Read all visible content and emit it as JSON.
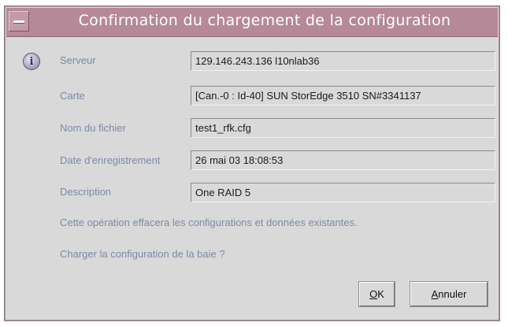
{
  "dialog": {
    "title": "Confirmation du chargement de la configuration"
  },
  "fields": [
    {
      "label": "Serveur",
      "value": "129.146.243.136 l10nlab36"
    },
    {
      "label": "Carte",
      "value": "[Can.-0 : Id-40] SUN StorEdge 3510 SN#3341137"
    },
    {
      "label": "Nom du fichier",
      "value": "test1_rfk.cfg"
    },
    {
      "label": "Date d'enregistrement",
      "value": "26 mai 03 18:08:53"
    },
    {
      "label": "Description",
      "value": "One RAID 5"
    }
  ],
  "messages": {
    "warning": "Cette opération effacera les configurations et données existantes.",
    "question": "Charger la configuration de la baie ?"
  },
  "buttons": {
    "ok": {
      "mnemonic": "O",
      "rest": "K"
    },
    "cancel": {
      "mnemonic": "A",
      "rest": "nnuler"
    }
  },
  "icons": {
    "info": "info-icon",
    "window_menu": "window-menu-icon"
  },
  "colors": {
    "titlebar": "#b58998",
    "label_text": "#7a8aa8",
    "dialog_bg": "#d9d9d9"
  }
}
